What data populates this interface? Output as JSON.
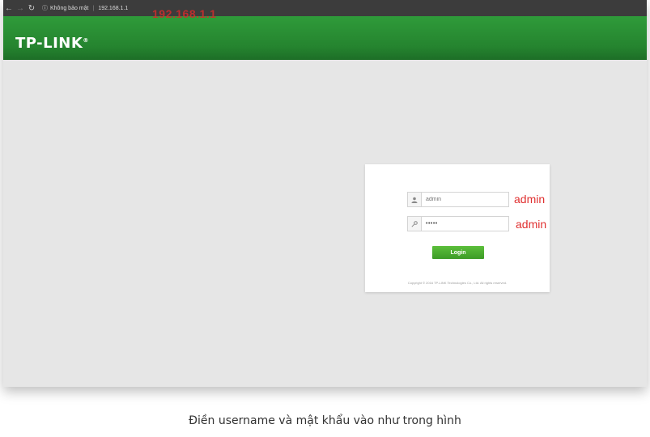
{
  "browser": {
    "security_label": "Không bảo mật",
    "url": "192.168.1.1"
  },
  "annotations": {
    "ip_overlay": "192.168.1.1",
    "username_value": "admin",
    "password_value": "admin"
  },
  "header": {
    "logo_text": "TP-LINK",
    "logo_mark": "®"
  },
  "login": {
    "username_placeholder": "admin",
    "password_value": "•••••",
    "button_label": "Login",
    "copyright": "Copyright © 2016 TP-LINK Technologies Co., Ltd. All rights reserved."
  },
  "caption": "Điền username và mật khẩu vào như trong hình",
  "colors": {
    "header_green": "#25842f",
    "button_green": "#4caf30",
    "annotation_red": "#e03030"
  }
}
